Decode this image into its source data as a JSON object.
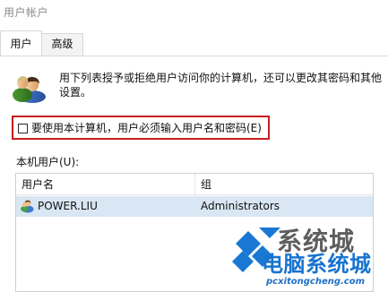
{
  "window": {
    "title": "用户帐户"
  },
  "tabs": [
    {
      "label": "用户",
      "active": true
    },
    {
      "label": "高级",
      "active": false
    }
  ],
  "panel": {
    "description": "用下列表授予或拒绝用户访问你的计算机，还可以更改其密码和其他设置。",
    "checkbox": {
      "label": "要使用本计算机，用户必须输入用户名和密码(E)",
      "checked": false
    },
    "users_label": "本机用户(U):",
    "list": {
      "columns": [
        "用户名",
        "组"
      ],
      "rows": [
        {
          "user": "POWER.LIU",
          "group": "Administrators",
          "selected": true
        }
      ]
    }
  },
  "watermark": {
    "big": "系统城",
    "mid": "电脑系统城",
    "small": "pcxitongcheng.com"
  },
  "colors": {
    "highlight": "#c51f20",
    "selected_row": "#d9e6f3",
    "tab_border": "#d8d8d8",
    "watermark_blue": "#1874cf",
    "watermark_gray": "#5e5e5e"
  }
}
